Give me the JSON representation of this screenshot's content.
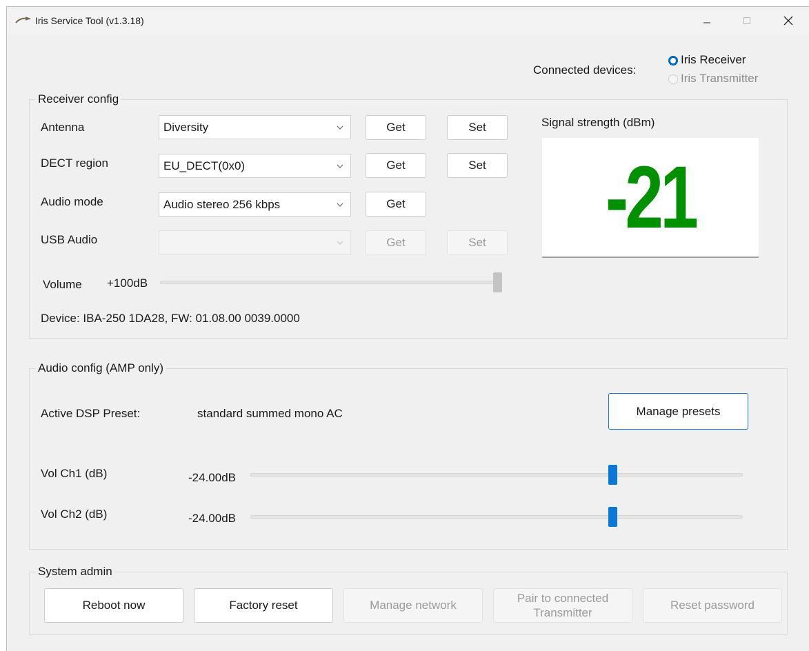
{
  "window": {
    "title": "Iris Service Tool (v1.3.18)",
    "min_glyph": "—",
    "max_glyph": "□",
    "close_glyph": "✕"
  },
  "connected": {
    "label": "Connected devices:",
    "options": [
      {
        "label": "Iris Receiver",
        "selected": true,
        "enabled": true
      },
      {
        "label": "Iris Transmitter",
        "selected": false,
        "enabled": false
      }
    ]
  },
  "receiver": {
    "title": "Receiver config",
    "rows": [
      {
        "label": "Antenna",
        "value": "Diversity",
        "get": "Get",
        "set": "Set",
        "enabled": true
      },
      {
        "label": "DECT region",
        "value": "EU_DECT(0x0)",
        "get": "Get",
        "set": "Set",
        "enabled": true
      },
      {
        "label": "Audio mode",
        "value": "Audio stereo 256 kbps",
        "get": "Get",
        "enabled": true
      },
      {
        "label": "USB Audio",
        "value": "",
        "get": "Get",
        "set": "Set",
        "enabled": false
      }
    ],
    "volume_label": "Volume",
    "volume_value": "+100dB",
    "volume_level": 1.0,
    "device_info": "Device: IBA-250 1DA28, FW: 01.08.00 0039.0000"
  },
  "signal": {
    "title": "Signal strength (dBm)",
    "value": "-21",
    "color": "#009000"
  },
  "audio": {
    "title": "Audio config (AMP only)",
    "preset_label": "Active DSP Preset:",
    "preset_value": "standard summed mono AC",
    "manage_presets": "Manage presets",
    "channels": [
      {
        "label": "Vol Ch1 (dB)",
        "value": "-24.00dB",
        "level": 0.74
      },
      {
        "label": "Vol Ch2 (dB)",
        "value": "-24.00dB",
        "level": 0.74
      }
    ]
  },
  "admin": {
    "title": "System admin",
    "buttons": [
      {
        "label": "Reboot now",
        "enabled": true
      },
      {
        "label": "Factory reset",
        "enabled": true
      },
      {
        "label": "Manage network",
        "enabled": false
      },
      {
        "label": "Pair to connected Transmitter",
        "enabled": false
      },
      {
        "label": "Reset password",
        "enabled": false
      }
    ]
  },
  "colors": {
    "accent": "#0067c0",
    "slider_thumb": "#0a78d7"
  }
}
